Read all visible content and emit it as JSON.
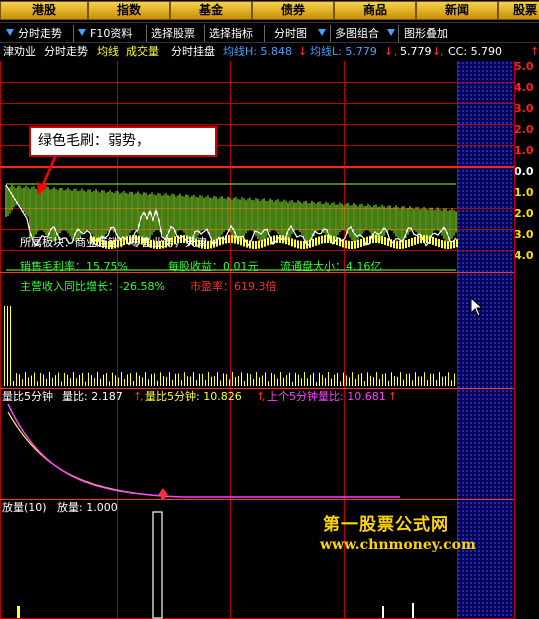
{
  "top_tabs": [
    "港股",
    "指数",
    "基金",
    "债券",
    "商品",
    "新闻",
    "股票"
  ],
  "toolbar": {
    "items": [
      "分时走势",
      "F10资料",
      "选择股票",
      "选择指标",
      "分时图",
      "多图组合",
      "图形叠加"
    ]
  },
  "indicator_line": {
    "stock": "津劝业",
    "chart_mode": "分时走势",
    "ma_label": "均线",
    "volume_label": "成交量",
    "ticker_label": "分时挂盘",
    "avg_h": "均线H: 5.848",
    "avg_l": "均线L: 5.779",
    "val": "5.779",
    "cc": "CC: 5.790"
  },
  "axis_labels": [
    "5.0",
    "4.0",
    "3.0",
    "2.0",
    "1.0",
    "0.0",
    "1.0",
    "2.0",
    "3.0",
    "4.0"
  ],
  "callout": {
    "text": "绿色毛刷：弱势，"
  },
  "info_overlay": {
    "row1": "所属板块：商业连锁，零售业务，天津",
    "margin": "销售毛利率：15.75%",
    "eps": "每股收益：0.01元",
    "float": "流通盘大小：4.16亿",
    "revenue": "主营收入同比增长：-26.58%",
    "pe": "市盈率：619.3倍"
  },
  "volume_ratio_title": {
    "name": "量比5分钟",
    "ratio": "量比: 2.187",
    "ratio5": "量比5分钟: 10.826",
    "prev5": "上个5分钟量比: 10.681"
  },
  "fangliang_title": {
    "name": "放量(10)",
    "value": "放量: 1.000"
  },
  "watermark": {
    "line1": "第一股票公式网",
    "line2": "www.chnmoney.com"
  },
  "colors": {
    "tab_gold": "#e8b820",
    "grid_red": "#b00000",
    "right_blue": "#000060",
    "brush_green": "#8cff2c",
    "brush_yellow": "#ffff33",
    "avg_cyan": "#4aa0ff",
    "ratio_magenta": "#ff40ff"
  },
  "icons": [
    "down-arrow-icon",
    "up-arrow-icon",
    "red-pointer-arrow-icon",
    "mouse-cursor-icon"
  ]
}
